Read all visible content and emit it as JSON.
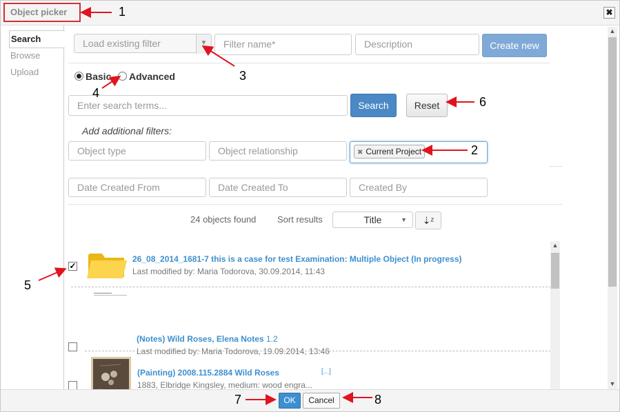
{
  "dialog": {
    "title": "Object picker",
    "close_icon": "close-icon"
  },
  "nav": {
    "items": [
      {
        "label": "Search"
      },
      {
        "label": "Browse"
      },
      {
        "label": "Upload"
      }
    ]
  },
  "filter_bar": {
    "load_filter_placeholder": "Load existing filter",
    "filter_name_placeholder": "Filter name*",
    "description_placeholder": "Description",
    "create_new_label": "Create new"
  },
  "mode": {
    "basic_label": "Basic",
    "advanced_label": "Advanced",
    "selected": "Basic"
  },
  "search": {
    "placeholder": "Enter search terms...",
    "search_label": "Search",
    "reset_label": "Reset"
  },
  "filters": {
    "heading": "Add additional filters:",
    "object_type_placeholder": "Object type",
    "object_relationship_placeholder": "Object relationship",
    "context_tag": "Current Project",
    "date_from_placeholder": "Date Created From",
    "date_to_placeholder": "Date Created To",
    "created_by_placeholder": "Created By"
  },
  "results": {
    "count_text": "24 objects found",
    "sort_label": "Sort results",
    "sort_value": "Title",
    "items": [
      {
        "title": "26_08_2014_1681-7 this is a case for test Examination: Multiple Object (In progress)",
        "version": "",
        "meta": "Last modified by: Maria Todorova, 30.09.2014, 11:43",
        "checked": true,
        "icon": "folder-icon"
      },
      {
        "title": "(Notes) Wild Roses, Elena Notes",
        "version": "1.2",
        "meta": "Last modified by: Maria Todorova, 19.09.2014, 13:46",
        "checked": false,
        "icon": "document-thumbnail"
      },
      {
        "title": "(Painting) 2008.115.2884 Wild Roses",
        "version": "",
        "more": "[...]",
        "meta": "1883, Elbridge Kingsley, medium: wood engra...",
        "checked": false,
        "icon": "painting-thumbnail"
      }
    ]
  },
  "footer": {
    "ok_label": "OK",
    "cancel_label": "Cancel"
  },
  "annotations": {
    "labels": [
      "1",
      "2",
      "3",
      "4",
      "5",
      "6",
      "7",
      "8"
    ],
    "arrow_color": "#e0141e"
  }
}
